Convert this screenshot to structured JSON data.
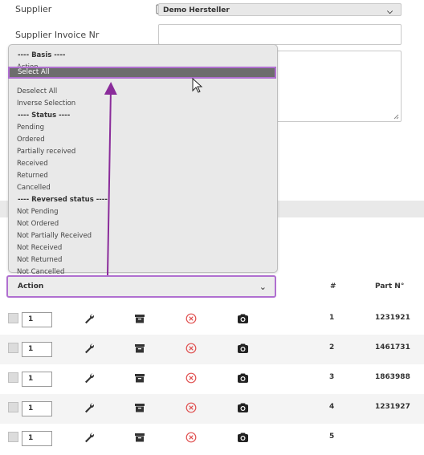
{
  "form": {
    "supplier_label": "Supplier",
    "supplier_value": "Demo Hersteller",
    "invoice_label": "Supplier Invoice Nr"
  },
  "dropdown": {
    "options": [
      {
        "label": "---- Basis ----",
        "group": true
      },
      {
        "label": "Action"
      },
      {
        "label": "Select All",
        "selected": true
      },
      {
        "label": "Deselect All"
      },
      {
        "label": "Inverse Selection"
      },
      {
        "label": "---- Status ----",
        "group": true
      },
      {
        "label": "Pending"
      },
      {
        "label": "Ordered"
      },
      {
        "label": "Partially received"
      },
      {
        "label": "Received"
      },
      {
        "label": "Returned"
      },
      {
        "label": "Cancelled"
      },
      {
        "label": "---- Reversed status ----",
        "group": true
      },
      {
        "label": "Not Pending"
      },
      {
        "label": "Not Ordered"
      },
      {
        "label": "Not Partially Received"
      },
      {
        "label": "Not Received"
      },
      {
        "label": "Not Returned"
      },
      {
        "label": "Not Cancelled"
      }
    ]
  },
  "action_select": {
    "label": "Action"
  },
  "table": {
    "headers": {
      "index": "#",
      "part": "Part N°"
    },
    "rows": [
      {
        "qty": "1",
        "index": "1",
        "part": "1231921"
      },
      {
        "qty": "1",
        "index": "2",
        "part": "1461731"
      },
      {
        "qty": "1",
        "index": "3",
        "part": "1863988"
      },
      {
        "qty": "1",
        "index": "4",
        "part": "1231927"
      },
      {
        "qty": "1",
        "index": "5",
        "part": ""
      }
    ]
  },
  "icons": [
    "list-icon",
    "chevron-down-icon",
    "cursor-pointer-icon",
    "wrench-icon",
    "archive-icon",
    "cancel-circle-icon",
    "camera-icon"
  ],
  "colors": {
    "highlight": "#b06fd0",
    "annotation_arrow": "#8a2c9a",
    "selected_bg": "#6d6d6d",
    "cancel_icon": "#e05050"
  }
}
